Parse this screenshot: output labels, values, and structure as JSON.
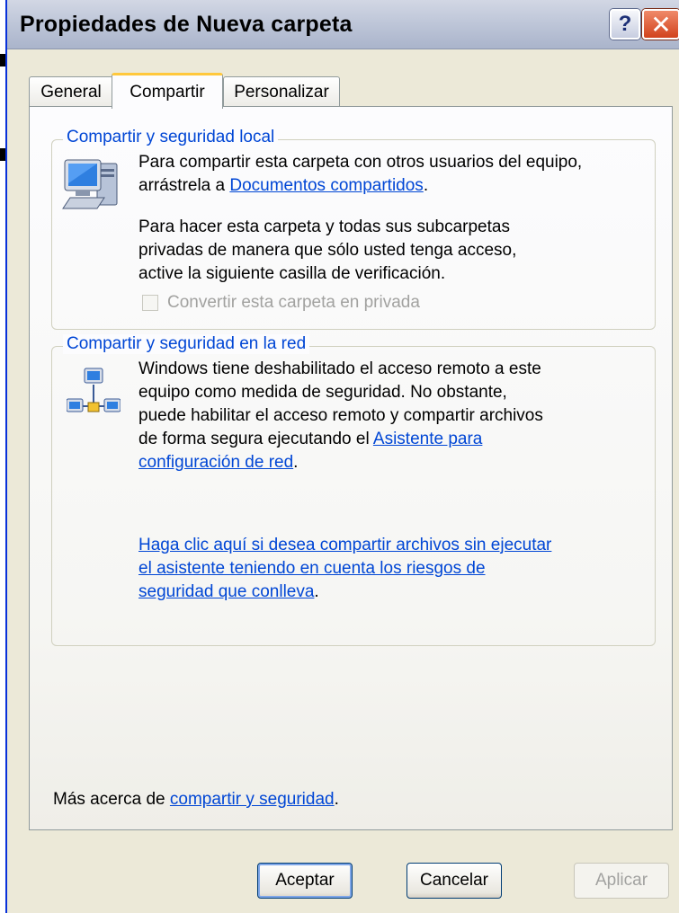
{
  "window": {
    "title": "Propiedades de Nueva carpeta",
    "help_glyph": "?",
    "close_glyph": "✕"
  },
  "tabs": [
    {
      "label": "General",
      "active": false
    },
    {
      "label": "Compartir",
      "active": true
    },
    {
      "label": "Personalizar",
      "active": false
    }
  ],
  "local": {
    "legend": "Compartir y seguridad local",
    "icon": "computer-icon",
    "line1": "Para compartir esta carpeta con otros usuarios del equipo,",
    "line2_pre": "arrástrela a ",
    "line2_link": "Documentos compartidos",
    "line2_post": ".",
    "para2": [
      "Para hacer esta carpeta y todas sus subcarpetas",
      "privadas de manera que sólo usted tenga acceso,",
      "active la siguiente casilla de verificación."
    ],
    "checkbox_label": "Convertir esta carpeta en privada",
    "checkbox_checked": false,
    "checkbox_enabled": false
  },
  "network": {
    "legend": "Compartir y seguridad en la red",
    "icon": "network-icon",
    "lines": [
      "Windows tiene deshabilitado el acceso remoto a este",
      "equipo como medida de seguridad. No obstante,",
      "puede habilitar el acceso remoto y compartir archivos"
    ],
    "line4_pre": "de forma segura ejecutando el ",
    "line4_link": "Asistente para",
    "line5_link": "configuración de red",
    "line5_post": ".",
    "risk_link_lines": [
      "Haga clic aquí si desea compartir archivos sin ejecutar",
      "el asistente teniendo en cuenta los riesgos de",
      "seguridad que conlleva"
    ],
    "risk_post": "."
  },
  "footer": {
    "pre": "Más acerca de ",
    "link": "compartir y seguridad",
    "post": "."
  },
  "buttons": {
    "ok": "Aceptar",
    "cancel": "Cancelar",
    "apply": "Aplicar"
  },
  "colors": {
    "accent_link": "#0046d5",
    "tab_highlight": "#ffc83c",
    "close_red": "#d2421c"
  }
}
